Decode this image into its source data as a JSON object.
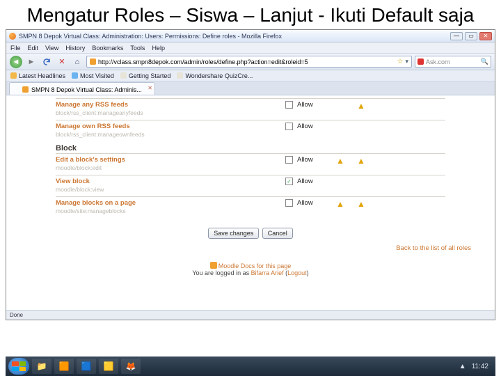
{
  "slide_title": "Mengatur Roles – Siswa – Lanjut - Ikuti Default saja",
  "browser": {
    "window_title": "SMPN 8 Depok Virtual Class: Administration: Users: Permissions: Define roles - Mozilla Firefox",
    "menu": [
      "File",
      "Edit",
      "View",
      "History",
      "Bookmarks",
      "Tools",
      "Help"
    ],
    "url": "http://vclass.smpn8depok.com/admin/roles/define.php?action=edit&roleid=5",
    "search_placeholder": "Ask.com",
    "bookmarks": [
      "Latest Headlines",
      "Most Visited",
      "Getting Started",
      "Wondershare QuizCre..."
    ],
    "tab_label": "SMPN 8 Depok Virtual Class: Adminis...",
    "status": "Done"
  },
  "perms": {
    "allow_label": "Allow",
    "rows": [
      {
        "name": "Manage any RSS feeds",
        "code": "block/rss_client:manageanyfeeds",
        "checked": false,
        "risk1": true,
        "risk2": false
      },
      {
        "name": "Manage own RSS feeds",
        "code": "block/rss_client:manageownfeeds",
        "checked": false,
        "risk1": false,
        "risk2": false
      }
    ],
    "section": "Block",
    "block_rows": [
      {
        "name": "Edit a block's settings",
        "code": "moodle/block:edit",
        "checked": false,
        "risk1": true,
        "risk2": true
      },
      {
        "name": "View block",
        "code": "moodle/block:view",
        "checked": true,
        "risk1": false,
        "risk2": false
      },
      {
        "name": "Manage blocks on a page",
        "code": "moodle/site:manageblocks",
        "checked": false,
        "risk1": true,
        "risk2": true
      }
    ],
    "save_label": "Save changes",
    "cancel_label": "Cancel",
    "back_link": "Back to the list of all roles"
  },
  "foot": {
    "docs": "Moodle Docs for this page",
    "logged_pre": "You are logged in as ",
    "user": "Bifarra Arief",
    "logout": "Logout"
  },
  "tray": {
    "arrow": "▲",
    "time": "11:42"
  }
}
